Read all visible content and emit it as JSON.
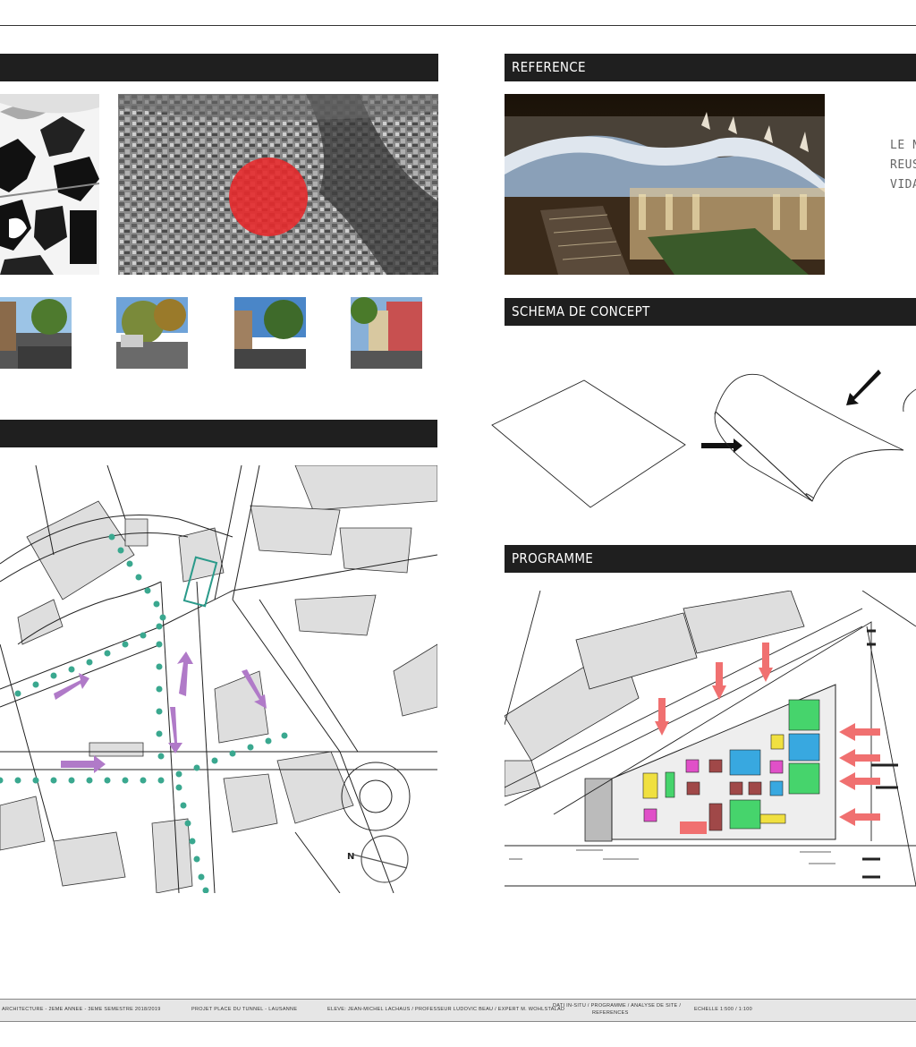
{
  "sections": {
    "reference": "REFERENCE",
    "schema": "SCHEMA DE CONCEPT",
    "programme": "PROGRAMME"
  },
  "reference_text": [
    "LE N",
    "REUS",
    "VIDA"
  ],
  "footer": {
    "col1": "ARCHITECTURE - 2EME ANNEE - 3EME SEMESTRE 2018/2019",
    "col2": "PROJET PLACE DU TUNNEL - LAUSANNE",
    "col3": "ELEVE: JEAN-MICHEL LACHAUS / PROFESSEUR LUDOVIC BEAU / EXPERT M. WOHLSTALAD",
    "col4a": "DATI IN-SITU / PROGRAMME / ANALYSE DE SITE /",
    "col4b": "REFERENCES",
    "col5": "ECHELLE 1:500 / 1:100"
  },
  "colors": {
    "bar": "#1f1f1f",
    "red_zone": "#e8282a",
    "path_teal": "#3aa88f",
    "arrow_purple": "#b07ac8",
    "arrow_salmon": "#f07070",
    "prog_green": "#46d46c",
    "prog_blue": "#38a8e0",
    "prog_yellow": "#f0e040",
    "prog_pink": "#e050c8",
    "prog_brown": "#a04848"
  }
}
